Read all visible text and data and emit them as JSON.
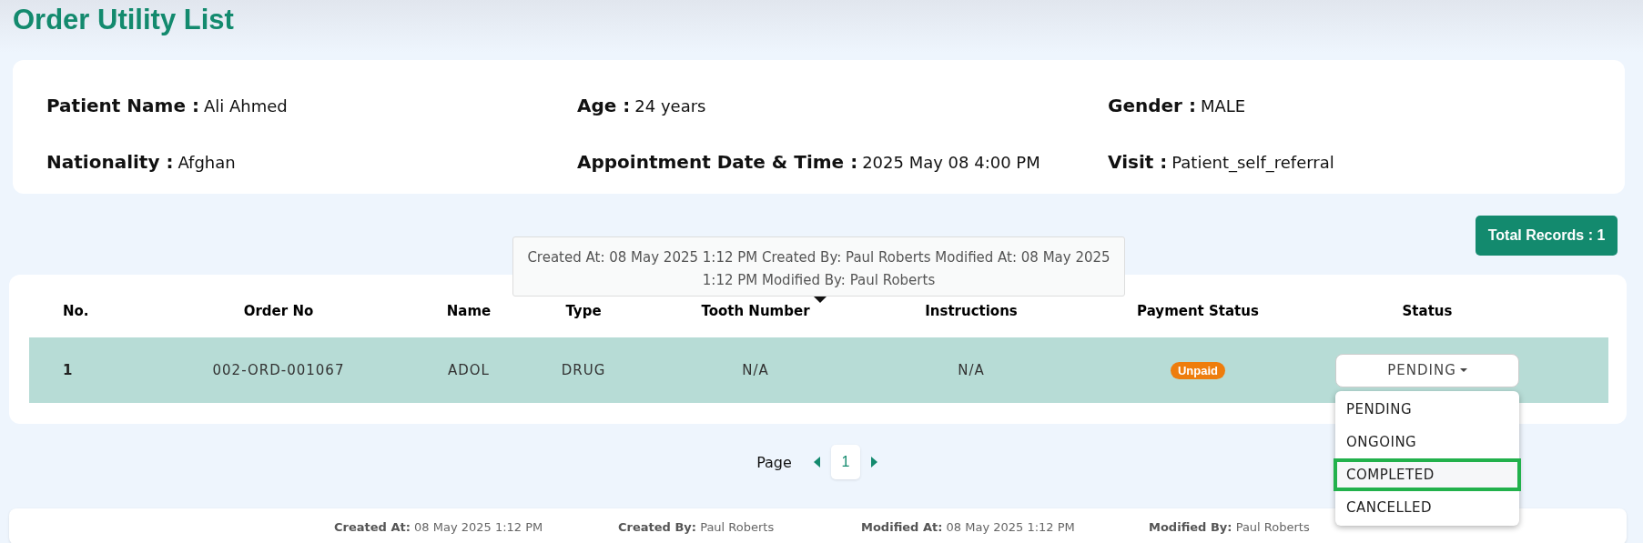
{
  "page_title": "Order Utility List",
  "patient_info": [
    {
      "label": "Patient Name :",
      "value": "Ali Ahmed"
    },
    {
      "label": "Age :",
      "value": "24 years"
    },
    {
      "label": "Gender :",
      "value": "MALE"
    },
    {
      "label": "Nationality :",
      "value": "Afghan"
    },
    {
      "label": "Appointment Date & Time :",
      "value": "2025 May 08 4:00 PM"
    },
    {
      "label": "Visit :",
      "value": "Patient_self_referral"
    }
  ],
  "total_records": "Total Records : 1",
  "table": {
    "columns": [
      "No.",
      "Order No",
      "Name",
      "Type",
      "Tooth Number",
      "Instructions",
      "Payment Status",
      "Status"
    ],
    "rows": [
      {
        "no": "1",
        "order_no": "002-ORD-001067",
        "name": "ADOL",
        "type": "DRUG",
        "tooth_number": "N/A",
        "instructions": "N/A",
        "payment_status": "Unpaid",
        "status": "PENDING"
      }
    ]
  },
  "tooltip": "Created At: 08 May 2025 1:12 PM Created By: Paul Roberts Modified At: 08 May 2025 1:12 PM Modified By: Paul Roberts",
  "status_menu": [
    {
      "label": "PENDING",
      "selected": false
    },
    {
      "label": "ONGOING",
      "selected": false
    },
    {
      "label": "COMPLETED",
      "selected": true
    },
    {
      "label": "CANCELLED",
      "selected": false
    }
  ],
  "pagination": {
    "label": "Page",
    "pages": [
      {
        "label": "1",
        "selected": true
      }
    ]
  },
  "footer": [
    {
      "label": "Created At:",
      "value": "08 May 2025 1:12 PM"
    },
    {
      "label": "Created By:",
      "value": "Paul Roberts"
    },
    {
      "label": "Modified At:",
      "value": "08 May 2025 1:12 PM"
    },
    {
      "label": "Modified By:",
      "value": "Paul Roberts"
    }
  ]
}
